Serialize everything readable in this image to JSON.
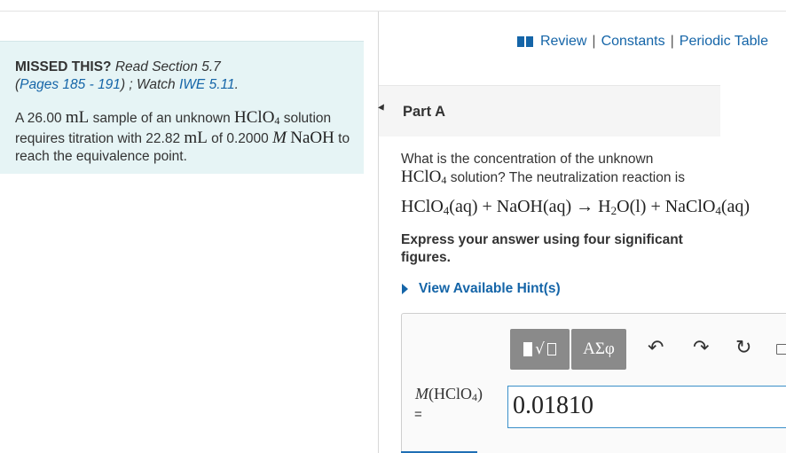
{
  "header_links": {
    "review": "Review",
    "constants": "Constants",
    "periodic_table": "Periodic Table",
    "separator": "|"
  },
  "info": {
    "missed_label": "MISSED THIS?",
    "read_section": "Read Section 5.7",
    "pages_open": "(",
    "pages_link": "Pages 185 - 191",
    "pages_close": ")",
    "watch_prefix": "; Watch",
    "watch_link": "IWE 5.11",
    "watch_suffix": ".",
    "problem": {
      "t1": "A 26.00",
      "unit1": "mL",
      "t2": "sample of an unknown",
      "acid": "HClO",
      "acid_sub": "4",
      "t3": "solution requires titration with 22.82",
      "unit2": "mL",
      "t4": "of 0.2000",
      "molar": "M",
      "base": "NaOH",
      "t5": "to reach the equivalence point."
    }
  },
  "part": {
    "title": "Part A"
  },
  "question": {
    "line1": "What is the concentration of the unknown",
    "acid": "HClO",
    "acid_sub": "4",
    "line2": "solution? The neutralization reaction is",
    "equation": {
      "r1": "HClO",
      "r1_sub": "4",
      "r1_state": "(aq) + NaOH(aq) → H",
      "p1_sub": "2",
      "p1": "O(l) + NaClO",
      "p2_sub": "4",
      "p2_state": "(aq)"
    },
    "instructions": "Express your answer using four significant figures.",
    "hints_label": "View Available Hint(s)"
  },
  "answer": {
    "greek_label": "ΑΣφ",
    "label_var": "M",
    "label_open": "(HClO",
    "label_sub": "4",
    "label_close": ")",
    "equals": "=",
    "value": "0.01810"
  },
  "icons": {
    "undo": "↶",
    "redo": "↷",
    "reset": "↻",
    "sqrt": "√"
  },
  "colors": {
    "link": "#1565a8",
    "panel_bg": "#e6f4f5",
    "button_gray": "#8a8a8a",
    "input_border": "#3a8fc9"
  }
}
